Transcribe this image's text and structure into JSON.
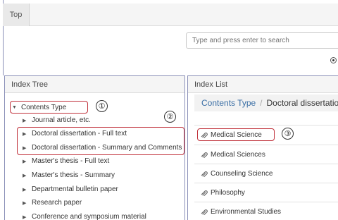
{
  "tabs": {
    "top_label": "Top"
  },
  "search": {
    "placeholder": "Type and press enter to search"
  },
  "index_tree": {
    "title": "Index Tree",
    "root": "Contents Type",
    "items": [
      "Journal article, etc.",
      "Doctoral dissertation - Full text",
      "Doctoral dissertation - Summary and Comments",
      "Master's thesis - Full text",
      "Master's thesis - Summary",
      "Departmental bulletin paper",
      "Research paper",
      "Conference and symposium material"
    ]
  },
  "index_list": {
    "title": "Index List",
    "breadcrumb": {
      "link": "Contents Type",
      "separator": "/",
      "current": "Doctoral dissertation"
    },
    "items": [
      "Medical Science",
      "Medical Sciences",
      "Counseling Science",
      "Philosophy",
      "Environmental Studies"
    ]
  },
  "callouts": [
    "①",
    "②",
    "③"
  ],
  "colors": {
    "highlight_border": "#c0303a",
    "link": "#3a6ea5",
    "panel_border": "#8a90b8"
  },
  "icons": {
    "expanded": "triangle-down-icon",
    "collapsed": "triangle-right-icon",
    "list_item": "paperclip-icon"
  }
}
